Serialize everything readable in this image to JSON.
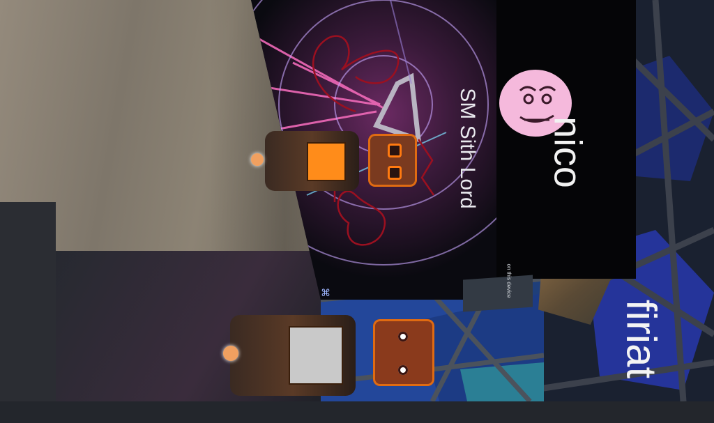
{
  "scene": {
    "channel_label": "SM Sith Lord",
    "players": [
      {
        "name": "nico"
      },
      {
        "name": "firiat"
      }
    ],
    "note_text": "on this device",
    "colors": {
      "robot_orange": "#e06b12",
      "robot_body": "#5a3a26",
      "screen_magenta": "#d2459c",
      "doodle_red": "#9b1020",
      "hex_blue": "#1f3f7a"
    },
    "icons": {
      "corner": "⌘"
    }
  }
}
